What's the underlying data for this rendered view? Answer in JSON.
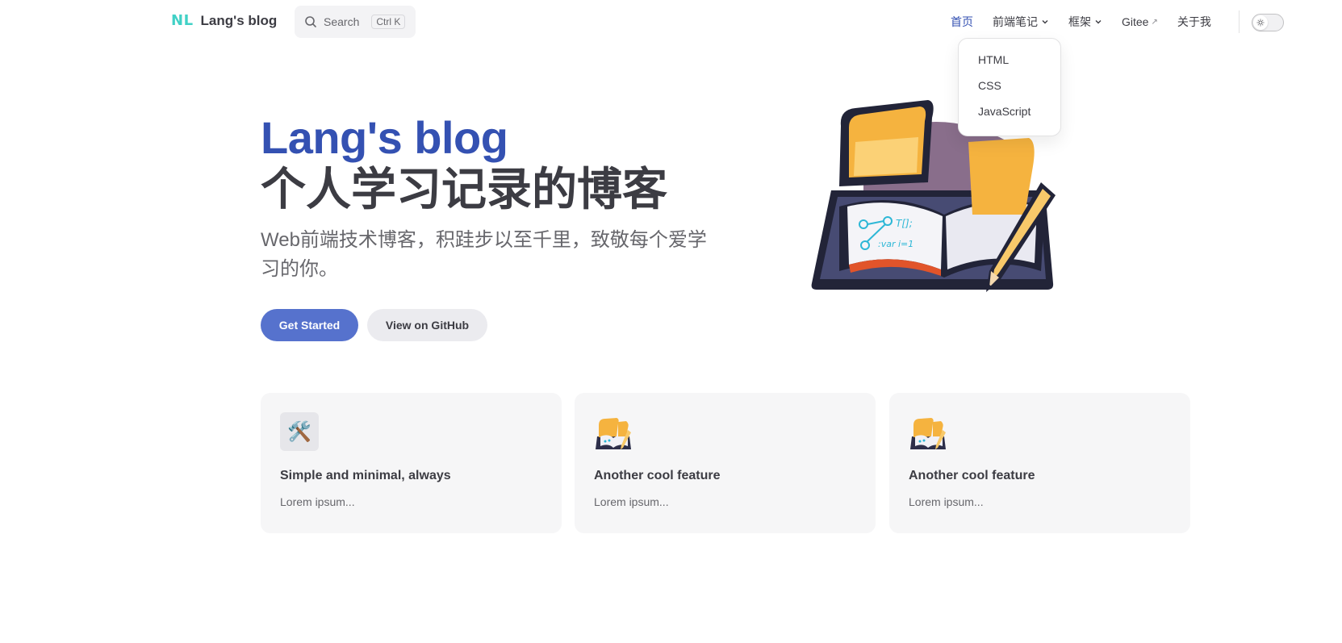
{
  "nav": {
    "logo_mark": "NL",
    "site_title": "Lang's blog",
    "search": {
      "label": "Search",
      "shortcut": "Ctrl K"
    },
    "links": [
      {
        "label": "首页",
        "active": true
      },
      {
        "label": "前端笔记",
        "has_dropdown": true
      },
      {
        "label": "框架",
        "has_dropdown": true
      },
      {
        "label": "Gitee",
        "external": true
      },
      {
        "label": "关于我"
      }
    ],
    "external_mark": "↗"
  },
  "dropdown": {
    "items": [
      "HTML",
      "CSS",
      "JavaScript"
    ]
  },
  "hero": {
    "name": "Lang's blog",
    "text": "个人学习记录的博客",
    "tagline": "Web前端技术博客，积跬步以至千里，致敬每个爱学习的你。",
    "actions": [
      {
        "label": "Get Started",
        "theme": "brand"
      },
      {
        "label": "View on GitHub",
        "theme": "alt"
      }
    ]
  },
  "features": [
    {
      "icon": "tools-icon",
      "icon_glyph": "🛠️",
      "title": "Simple and minimal, always",
      "details": "Lorem ipsum..."
    },
    {
      "icon": "book-logo-icon",
      "title": "Another cool feature",
      "details": "Lorem ipsum..."
    },
    {
      "icon": "book-logo-icon",
      "title": "Another cool feature",
      "details": "Lorem ipsum..."
    }
  ],
  "colors": {
    "brand": "#3451b2",
    "button_brand": "#5672cd",
    "logo_mark": "#41d1c6",
    "text": "#3c3c43",
    "muted": "#67676c",
    "card_bg": "#f6f6f7"
  }
}
